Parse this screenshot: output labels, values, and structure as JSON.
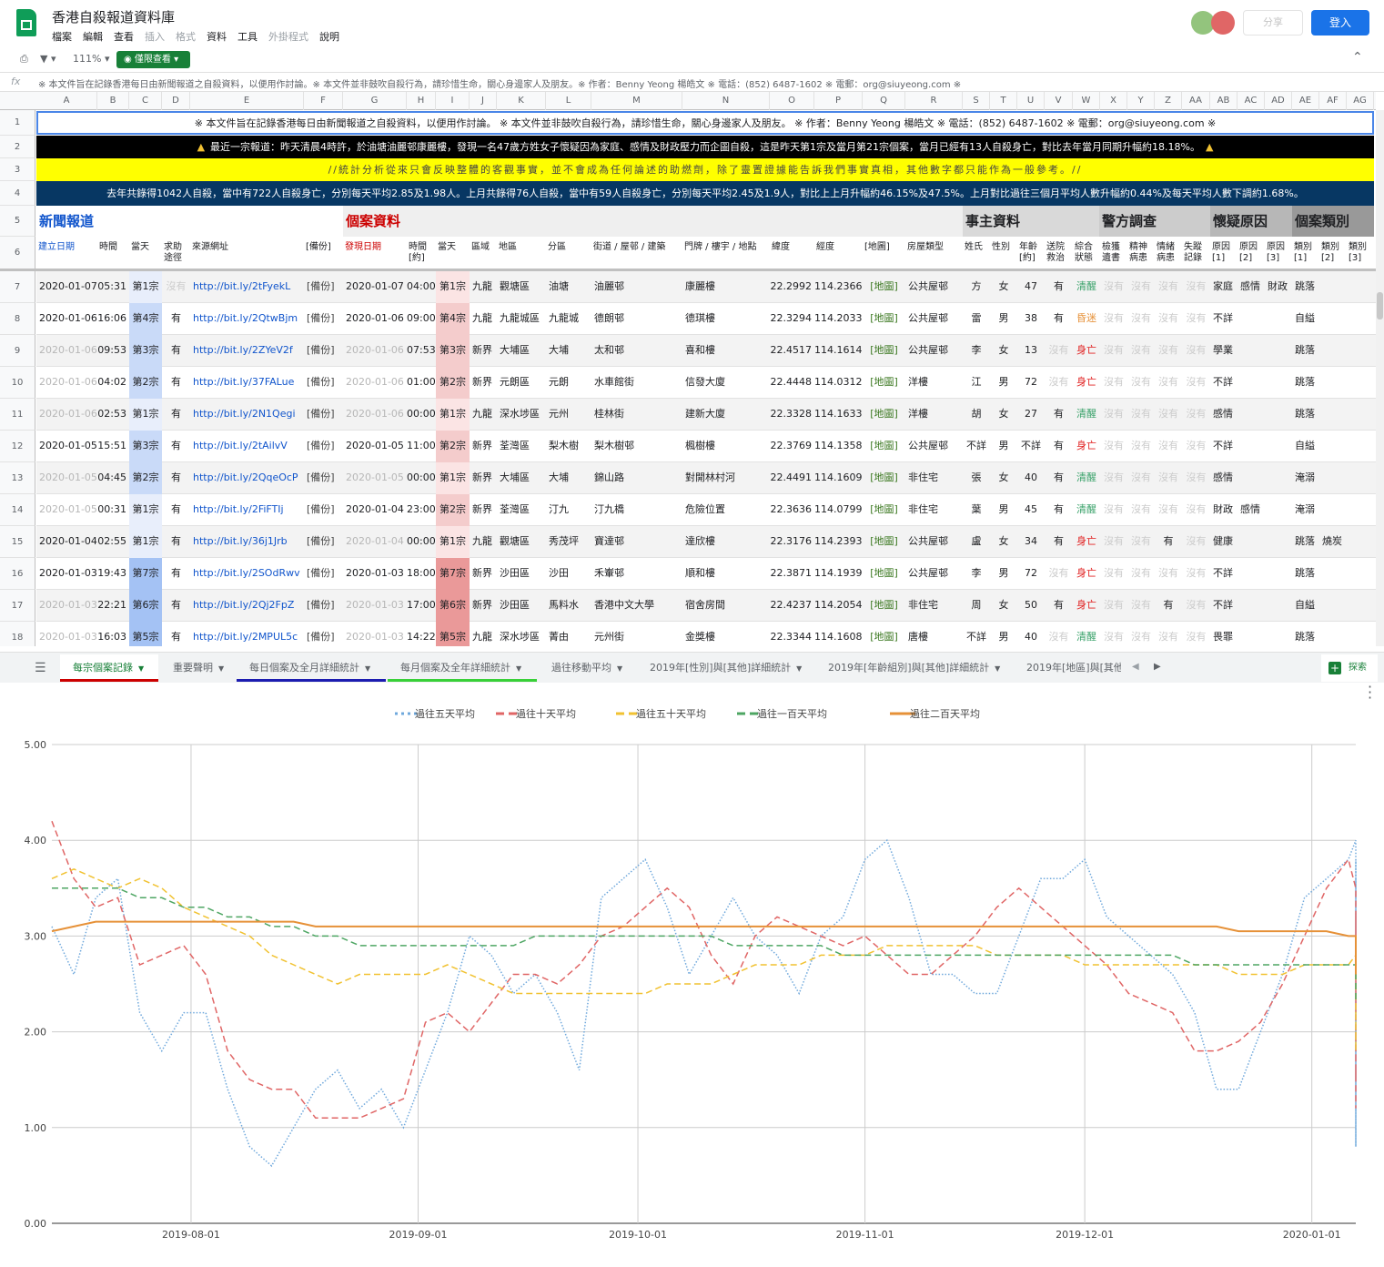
{
  "header": {
    "title": "香港自殺報道資料庫",
    "menu": [
      "檔案",
      "編輯",
      "查看",
      "插入",
      "格式",
      "資料",
      "工具",
      "外掛程式",
      "說明"
    ],
    "menu_dim": [
      false,
      false,
      false,
      true,
      true,
      false,
      false,
      true,
      false
    ],
    "share_label": "分享",
    "login_label": "登入"
  },
  "toolbar": {
    "zoom": "111%",
    "view_only": "僅限查看"
  },
  "formula": {
    "fx": "fx",
    "text": "※ 本文件旨在記錄香港每日由新聞報道之自殺資料，以便用作討論。※ 本文件並非鼓吹自殺行為，請珍惜生命，關心身邊家人及朋友。※ 作者：Benny Yeong 楊皓文 ※ 電話：(852) 6487-1602 ※ 電郵：org@siuyeong.com ※"
  },
  "columns": [
    "A",
    "B",
    "C",
    "D",
    "E",
    "F",
    "G",
    "H",
    "I",
    "J",
    "K",
    "L",
    "M",
    "N",
    "O",
    "P",
    "Q",
    "R",
    "S",
    "T",
    "U",
    "V",
    "W",
    "X",
    "Y",
    "Z",
    "AA",
    "AB",
    "AC",
    "AD",
    "AE",
    "AF",
    "AG"
  ],
  "banners": {
    "row1": "※ 本文件旨在記錄香港每日由新聞報道之自殺資料，以便用作討論。 ※ 本文件並非鼓吹自殺行為，請珍惜生命，關心身邊家人及朋友。 ※ 作者：Benny Yeong 楊皓文 ※ 電話：(852) 6487-1602 ※ 電郵：org@siuyeong.com ※",
    "row2": "最近一宗報道：昨天清晨4時許，於油塘油麗邨康麗樓，發現一名47歲方姓女子懷疑因為家庭、感情及財政壓力而企圖自殺，這是昨天第1宗及當月第21宗個案，當月已經有13人自殺身亡，對比去年當月同期升幅約18.18%。",
    "row2_warning": "▲",
    "row3": "//統計分析從來只會反映整體的客觀事實，並不會成為任何論述的助燃劑，除了靈置證據能告訴我們事實真相，其他數字都只能作為一般參考。//",
    "row4": "去年共錄得1042人自殺，當中有722人自殺身亡，分別每天平均2.85及1.98人。上月共錄得76人自殺，當中有59人自殺身亡，分別每天平均2.45及1.9人，對比上上月升幅約46.15%及47.5%。上月對比過往三個月平均人數升幅約0.44%及每天平均人數下調約1.68%。"
  },
  "sections": {
    "news": "新聞報道",
    "case": "個案資料",
    "person": "事主資料",
    "police": "警方調查",
    "reason": "懷疑原因",
    "category": "個案類別"
  },
  "headers_row6": [
    "建立日期",
    "時間",
    "當天",
    "求助途徑",
    "來源網址",
    "[備份]",
    "發現日期",
    "時間[約]",
    "當天",
    "區域",
    "地區",
    "分區",
    "街道 / 屋邨 / 建築",
    "門牌 / 樓宇 / 地點",
    "緯度",
    "經度",
    "[地圖]",
    "房屋類型",
    "姓氏",
    "性別",
    "年齡[約]",
    "送院救治",
    "綜合狀態",
    "檢獲遺書",
    "精神病患",
    "情緒病患",
    "失蹤記錄",
    "原因[1]",
    "原因[2]",
    "原因[3]",
    "類別[1]",
    "類別[2]",
    "類別[3]"
  ],
  "rows": [
    {
      "n": "7",
      "a": "2020-01-07",
      "b": "05:31",
      "c": "第1宗",
      "d": "沒有",
      "e": "http://bit.ly/2tFyekL",
      "f": "[備份]",
      "g": "2020-01-07",
      "h": "04:00",
      "i": "第1宗",
      "j": "九龍",
      "k": "觀塘區",
      "l": "油塘",
      "m": "油麗邨",
      "n2": "康麗樓",
      "o": "22.2992",
      "p": "114.2366",
      "q": "[地圖]",
      "r": "公共屋邨",
      "s": "方",
      "t": "女",
      "u": "47",
      "v": "有",
      "w": "清醒",
      "x": "沒有",
      "y": "沒有",
      "z": "沒有",
      "aa": "沒有",
      "ab": "家庭",
      "ac": "感情",
      "ad": "財政",
      "ae": "跳落",
      "af": "",
      "ag": ""
    },
    {
      "n": "8",
      "a": "2020-01-06",
      "b": "16:06",
      "c": "第4宗",
      "d": "有",
      "e": "http://bit.ly/2QtwBjm",
      "f": "[備份]",
      "g": "2020-01-06",
      "h": "09:00",
      "i": "第4宗",
      "j": "九龍",
      "k": "九龍城區",
      "l": "九龍城",
      "m": "德朗邨",
      "n2": "德琪樓",
      "o": "22.3294",
      "p": "114.2033",
      "q": "[地圖]",
      "r": "公共屋邨",
      "s": "雷",
      "t": "男",
      "u": "38",
      "v": "有",
      "w": "昏迷",
      "x": "沒有",
      "y": "沒有",
      "z": "沒有",
      "aa": "沒有",
      "ab": "不詳",
      "ac": "",
      "ad": "",
      "ae": "自縊",
      "af": "",
      "ag": ""
    },
    {
      "n": "9",
      "a": "2020-01-06",
      "b": "09:53",
      "c": "第3宗",
      "d": "有",
      "e": "http://bit.ly/2ZYeV2f",
      "f": "[備份]",
      "g": "2020-01-06",
      "h": "07:53",
      "i": "第3宗",
      "j": "新界",
      "k": "大埔區",
      "l": "大埔",
      "m": "太和邨",
      "n2": "喜和樓",
      "o": "22.4517",
      "p": "114.1614",
      "q": "[地圖]",
      "r": "公共屋邨",
      "s": "李",
      "t": "女",
      "u": "13",
      "v": "沒有",
      "w": "身亡",
      "x": "沒有",
      "y": "沒有",
      "z": "沒有",
      "aa": "沒有",
      "ab": "學業",
      "ac": "",
      "ad": "",
      "ae": "跳落",
      "af": "",
      "ag": ""
    },
    {
      "n": "10",
      "a": "2020-01-06",
      "b": "04:02",
      "c": "第2宗",
      "d": "有",
      "e": "http://bit.ly/37FALue",
      "f": "[備份]",
      "g": "2020-01-06",
      "h": "01:00",
      "i": "第2宗",
      "j": "新界",
      "k": "元朗區",
      "l": "元朗",
      "m": "水車館街",
      "n2": "信發大廈",
      "o": "22.4448",
      "p": "114.0312",
      "q": "[地圖]",
      "r": "洋樓",
      "s": "江",
      "t": "男",
      "u": "72",
      "v": "沒有",
      "w": "身亡",
      "x": "沒有",
      "y": "沒有",
      "z": "沒有",
      "aa": "沒有",
      "ab": "不詳",
      "ac": "",
      "ad": "",
      "ae": "跳落",
      "af": "",
      "ag": ""
    },
    {
      "n": "11",
      "a": "2020-01-06",
      "b": "02:53",
      "c": "第1宗",
      "d": "有",
      "e": "http://bit.ly/2N1Qegi",
      "f": "[備份]",
      "g": "2020-01-06",
      "h": "00:00",
      "i": "第1宗",
      "j": "九龍",
      "k": "深水埗區",
      "l": "元州",
      "m": "桂林街",
      "n2": "建新大廈",
      "o": "22.3328",
      "p": "114.1633",
      "q": "[地圖]",
      "r": "洋樓",
      "s": "胡",
      "t": "女",
      "u": "27",
      "v": "有",
      "w": "清醒",
      "x": "沒有",
      "y": "沒有",
      "z": "沒有",
      "aa": "沒有",
      "ab": "感情",
      "ac": "",
      "ad": "",
      "ae": "跳落",
      "af": "",
      "ag": ""
    },
    {
      "n": "12",
      "a": "2020-01-05",
      "b": "15:51",
      "c": "第3宗",
      "d": "有",
      "e": "http://bit.ly/2tAilvV",
      "f": "[備份]",
      "g": "2020-01-05",
      "h": "11:00",
      "i": "第2宗",
      "j": "新界",
      "k": "荃灣區",
      "l": "梨木樹",
      "m": "梨木樹邨",
      "n2": "楓樹樓",
      "o": "22.3769",
      "p": "114.1358",
      "q": "[地圖]",
      "r": "公共屋邨",
      "s": "不詳",
      "t": "男",
      "u": "不詳",
      "v": "有",
      "w": "身亡",
      "x": "沒有",
      "y": "沒有",
      "z": "沒有",
      "aa": "沒有",
      "ab": "不詳",
      "ac": "",
      "ad": "",
      "ae": "自縊",
      "af": "",
      "ag": ""
    },
    {
      "n": "13",
      "a": "2020-01-05",
      "b": "04:45",
      "c": "第2宗",
      "d": "有",
      "e": "http://bit.ly/2QqeOcP",
      "f": "[備份]",
      "g": "2020-01-05",
      "h": "00:00",
      "i": "第1宗",
      "j": "新界",
      "k": "大埔區",
      "l": "大埔",
      "m": "錦山路",
      "n2": "對開林村河",
      "o": "22.4491",
      "p": "114.1609",
      "q": "[地圖]",
      "r": "非住宅",
      "s": "張",
      "t": "女",
      "u": "40",
      "v": "有",
      "w": "清醒",
      "x": "沒有",
      "y": "沒有",
      "z": "沒有",
      "aa": "沒有",
      "ab": "感情",
      "ac": "",
      "ad": "",
      "ae": "淹溺",
      "af": "",
      "ag": ""
    },
    {
      "n": "14",
      "a": "2020-01-05",
      "b": "00:31",
      "c": "第1宗",
      "d": "有",
      "e": "http://bit.ly/2FiFTIj",
      "f": "[備份]",
      "g": "2020-01-04",
      "h": "23:00",
      "i": "第2宗",
      "j": "新界",
      "k": "荃灣區",
      "l": "汀九",
      "m": "汀九橋",
      "n2": "危險位置",
      "o": "22.3636",
      "p": "114.0799",
      "q": "[地圖]",
      "r": "非住宅",
      "s": "葉",
      "t": "男",
      "u": "45",
      "v": "有",
      "w": "清醒",
      "x": "沒有",
      "y": "沒有",
      "z": "沒有",
      "aa": "沒有",
      "ab": "財政",
      "ac": "感情",
      "ad": "",
      "ae": "淹溺",
      "af": "",
      "ag": ""
    },
    {
      "n": "15",
      "a": "2020-01-04",
      "b": "02:55",
      "c": "第1宗",
      "d": "有",
      "e": "http://bit.ly/36j1Jrb",
      "f": "[備份]",
      "g": "2020-01-04",
      "h": "00:00",
      "i": "第1宗",
      "j": "九龍",
      "k": "觀塘區",
      "l": "秀茂坪",
      "m": "寶達邨",
      "n2": "達欣樓",
      "o": "22.3176",
      "p": "114.2393",
      "q": "[地圖]",
      "r": "公共屋邨",
      "s": "盧",
      "t": "女",
      "u": "34",
      "v": "有",
      "w": "身亡",
      "x": "沒有",
      "y": "沒有",
      "z": "有",
      "aa": "沒有",
      "ab": "健康",
      "ac": "",
      "ad": "",
      "ae": "跳落",
      "af": "燒炭",
      "ag": ""
    },
    {
      "n": "16",
      "a": "2020-01-03",
      "b": "19:43",
      "c": "第7宗",
      "d": "有",
      "e": "http://bit.ly/2SOdRwv",
      "f": "[備份]",
      "g": "2020-01-03",
      "h": "18:00",
      "i": "第7宗",
      "j": "新界",
      "k": "沙田區",
      "l": "沙田",
      "m": "禾輋邨",
      "n2": "順和樓",
      "o": "22.3871",
      "p": "114.1939",
      "q": "[地圖]",
      "r": "公共屋邨",
      "s": "李",
      "t": "男",
      "u": "72",
      "v": "沒有",
      "w": "身亡",
      "x": "沒有",
      "y": "沒有",
      "z": "沒有",
      "aa": "沒有",
      "ab": "不詳",
      "ac": "",
      "ad": "",
      "ae": "跳落",
      "af": "",
      "ag": ""
    },
    {
      "n": "17",
      "a": "2020-01-03",
      "b": "22:21",
      "c": "第6宗",
      "d": "有",
      "e": "http://bit.ly/2Qj2FpZ",
      "f": "[備份]",
      "g": "2020-01-03",
      "h": "17:00",
      "i": "第6宗",
      "j": "新界",
      "k": "沙田區",
      "l": "馬料水",
      "m": "香港中文大學",
      "n2": "宿舍房間",
      "o": "22.4237",
      "p": "114.2054",
      "q": "[地圖]",
      "r": "非住宅",
      "s": "周",
      "t": "女",
      "u": "50",
      "v": "有",
      "w": "身亡",
      "x": "沒有",
      "y": "沒有",
      "z": "有",
      "aa": "沒有",
      "ab": "不詳",
      "ac": "",
      "ad": "",
      "ae": "自縊",
      "af": "",
      "ag": ""
    },
    {
      "n": "18",
      "a": "2020-01-03",
      "b": "16:03",
      "c": "第5宗",
      "d": "有",
      "e": "http://bit.ly/2MPUL5c",
      "f": "[備份]",
      "g": "2020-01-03",
      "h": "14:22",
      "i": "第5宗",
      "j": "九龍",
      "k": "深水埗區",
      "l": "菁由",
      "m": "元州街",
      "n2": "金獎樓",
      "o": "22.3344",
      "p": "114.1608",
      "q": "[地圖]",
      "r": "唐樓",
      "s": "不詳",
      "t": "男",
      "u": "40",
      "v": "沒有",
      "w": "清醒",
      "x": "沒有",
      "y": "沒有",
      "z": "沒有",
      "aa": "沒有",
      "ab": "畏罪",
      "ac": "",
      "ad": "",
      "ae": "跳落",
      "af": "",
      "ag": ""
    }
  ],
  "tabs": [
    "每宗個案記錄",
    "重要聲明",
    "每日個案及全月詳細統計",
    "每月個案及全年詳細統計",
    "過往移動平均",
    "2019年[性別]與[其他]詳細統計",
    "2019年[年齡組別]與[其他]詳細統計",
    "2019年[地區]與[其他"
  ],
  "explore_label": "探索",
  "colors": {
    "tab_red": "#cc0000",
    "tab_blue": "#1c1cb0",
    "tab_green": "#38d038",
    "series_5": "#6fa8dc",
    "series_10": "#e06666",
    "series_50": "#f1c232",
    "series_100": "#4ea663",
    "series_200": "#e69138"
  },
  "chart_data": {
    "type": "line",
    "ylim": [
      0,
      5
    ],
    "yticks": [
      "0.00",
      "1.00",
      "2.00",
      "3.00",
      "4.00",
      "5.00"
    ],
    "xticks": [
      "2019-08-01",
      "2019-09-01",
      "2019-10-01",
      "2019-11-01",
      "2019-12-01",
      "2020-01-01"
    ],
    "x_start": "2019-07-13",
    "x_end": "2020-01-07",
    "legend_position": "top",
    "grid": true,
    "series": [
      {
        "name": "過往五天平均",
        "style": "dotted",
        "step": 3,
        "values": [
          3.1,
          2.6,
          3.4,
          3.6,
          2.2,
          1.8,
          2.2,
          2.2,
          1.4,
          0.8,
          0.6,
          1.0,
          1.4,
          1.6,
          1.2,
          1.4,
          1.0,
          1.6,
          2.2,
          3.0,
          2.8,
          2.4,
          2.6,
          2.2,
          1.6,
          3.4,
          3.6,
          3.8,
          3.3,
          2.6,
          3.0,
          3.4,
          3.0,
          2.8,
          2.4,
          3.0,
          3.2,
          3.8,
          4.0,
          3.4,
          2.6,
          2.6,
          2.4,
          2.4,
          3.0,
          3.6,
          3.6,
          3.8,
          3.2,
          3.0,
          2.8,
          2.6,
          2.2,
          1.4,
          1.4,
          2.0,
          2.6,
          3.4,
          3.6,
          3.8,
          4.0,
          3.4,
          2.6,
          2.0,
          1.4,
          1.3,
          2.0,
          2.6,
          3.0,
          2.8,
          2.2,
          1.6,
          0.8,
          1.4,
          1.8,
          2.0,
          1.2,
          0.8,
          1.0,
          1.6,
          1.2,
          1.6,
          2.4,
          2.0,
          2.2,
          1.8,
          2.4,
          2.6,
          2.2,
          2.6,
          2.8,
          3.2,
          2.6,
          3.0,
          2.8,
          3.6,
          3.0,
          3.2,
          3.8,
          3.2
        ]
      },
      {
        "name": "過往十天平均",
        "style": "dashed",
        "step": 3,
        "values": [
          4.2,
          3.6,
          3.3,
          3.4,
          2.7,
          2.8,
          2.9,
          2.6,
          1.8,
          1.5,
          1.4,
          1.4,
          1.1,
          1.1,
          1.1,
          1.2,
          1.3,
          2.1,
          2.2,
          2.0,
          2.3,
          2.6,
          2.6,
          2.5,
          2.7,
          3.0,
          3.1,
          3.3,
          3.5,
          3.3,
          2.8,
          2.5,
          3.0,
          3.2,
          3.1,
          3.0,
          2.9,
          3.0,
          2.8,
          2.6,
          2.6,
          2.8,
          3.0,
          3.3,
          3.5,
          3.3,
          3.1,
          2.9,
          2.7,
          2.4,
          2.3,
          2.2,
          1.8,
          1.8,
          1.9,
          2.1,
          2.5,
          3.0,
          3.5,
          3.8,
          3.5,
          3.2,
          2.8,
          2.4,
          2.3,
          2.2,
          2.2,
          2.4,
          2.6,
          2.6,
          2.3,
          1.8,
          1.6,
          1.5,
          1.6,
          1.5,
          1.4,
          1.4,
          1.2,
          1.2,
          1.3,
          1.6,
          1.9,
          2.0,
          1.9,
          2.0,
          2.2,
          2.4,
          2.7,
          2.8,
          2.8,
          2.9,
          3.0,
          2.9,
          2.8,
          2.6,
          3.2,
          3.0,
          3.2,
          3.0
        ]
      },
      {
        "name": "過往五十天平均",
        "style": "dashed",
        "step": 3,
        "values": [
          3.6,
          3.7,
          3.6,
          3.5,
          3.6,
          3.5,
          3.3,
          3.2,
          3.1,
          3.0,
          2.8,
          2.7,
          2.6,
          2.5,
          2.6,
          2.6,
          2.6,
          2.6,
          2.7,
          2.6,
          2.5,
          2.4,
          2.4,
          2.4,
          2.4,
          2.4,
          2.4,
          2.4,
          2.5,
          2.5,
          2.5,
          2.6,
          2.7,
          2.7,
          2.7,
          2.8,
          2.8,
          2.8,
          2.9,
          2.9,
          2.9,
          2.9,
          2.9,
          2.8,
          2.8,
          2.8,
          2.8,
          2.7,
          2.7,
          2.7,
          2.7,
          2.7,
          2.7,
          2.7,
          2.6,
          2.6,
          2.6,
          2.7,
          2.7,
          2.7,
          2.8,
          2.8,
          2.7,
          2.6,
          2.6,
          2.5,
          2.5,
          2.4,
          2.3,
          2.3,
          2.3,
          2.2,
          2.1,
          2.1,
          2.1,
          2.1,
          2.1,
          2.1,
          2.1,
          2.0,
          1.9,
          1.9,
          1.8,
          1.8,
          1.8,
          1.8,
          1.9,
          1.9,
          1.9,
          1.9,
          1.9,
          1.9,
          2.0,
          2.0,
          2.1,
          2.1,
          2.2,
          2.2,
          2.3,
          2.3
        ]
      },
      {
        "name": "過往一百天平均",
        "style": "dashed",
        "step": 3,
        "values": [
          3.5,
          3.5,
          3.5,
          3.5,
          3.4,
          3.4,
          3.3,
          3.3,
          3.2,
          3.2,
          3.1,
          3.1,
          3.0,
          3.0,
          2.9,
          2.9,
          2.9,
          2.9,
          2.9,
          2.9,
          2.9,
          2.9,
          3.0,
          3.0,
          3.0,
          3.0,
          3.0,
          3.0,
          3.0,
          3.0,
          3.0,
          2.9,
          2.9,
          2.9,
          2.9,
          2.9,
          2.8,
          2.8,
          2.8,
          2.8,
          2.8,
          2.8,
          2.8,
          2.8,
          2.8,
          2.8,
          2.8,
          2.8,
          2.8,
          2.8,
          2.8,
          2.8,
          2.7,
          2.7,
          2.7,
          2.7,
          2.7,
          2.7,
          2.7,
          2.7,
          2.7,
          2.7,
          2.7,
          2.6,
          2.6,
          2.6,
          2.7,
          2.7,
          2.7,
          2.7,
          2.7,
          2.7,
          2.7,
          2.6,
          2.6,
          2.6,
          2.6,
          2.6,
          2.5,
          2.5,
          2.5,
          2.5,
          2.4,
          2.4,
          2.4,
          2.4,
          2.4,
          2.4,
          2.4,
          2.4,
          2.4,
          2.4,
          2.4,
          2.4,
          2.4,
          2.3,
          2.3,
          2.3,
          2.3,
          2.3
        ]
      },
      {
        "name": "過往二百天平均",
        "style": "solid",
        "step": 3,
        "values": [
          3.05,
          3.1,
          3.15,
          3.15,
          3.15,
          3.15,
          3.15,
          3.15,
          3.15,
          3.15,
          3.15,
          3.15,
          3.1,
          3.1,
          3.1,
          3.1,
          3.1,
          3.1,
          3.1,
          3.1,
          3.1,
          3.1,
          3.1,
          3.1,
          3.1,
          3.1,
          3.1,
          3.1,
          3.1,
          3.1,
          3.1,
          3.1,
          3.1,
          3.1,
          3.1,
          3.1,
          3.1,
          3.1,
          3.1,
          3.1,
          3.1,
          3.1,
          3.1,
          3.1,
          3.1,
          3.1,
          3.1,
          3.1,
          3.1,
          3.1,
          3.1,
          3.1,
          3.1,
          3.1,
          3.05,
          3.05,
          3.05,
          3.05,
          3.05,
          3.0,
          3.0,
          3.0,
          3.0,
          3.0,
          3.0,
          2.95,
          2.95,
          2.95,
          2.95,
          2.9,
          2.9,
          2.9,
          2.85,
          2.85,
          2.85,
          2.85,
          2.8,
          2.8,
          2.8,
          2.8,
          2.8,
          2.75,
          2.75,
          2.75,
          2.75,
          2.7,
          2.7,
          2.7,
          2.7,
          2.7,
          2.7,
          2.7,
          2.7,
          2.65,
          2.65,
          2.65,
          2.65,
          2.65,
          2.6,
          2.6
        ]
      }
    ]
  }
}
